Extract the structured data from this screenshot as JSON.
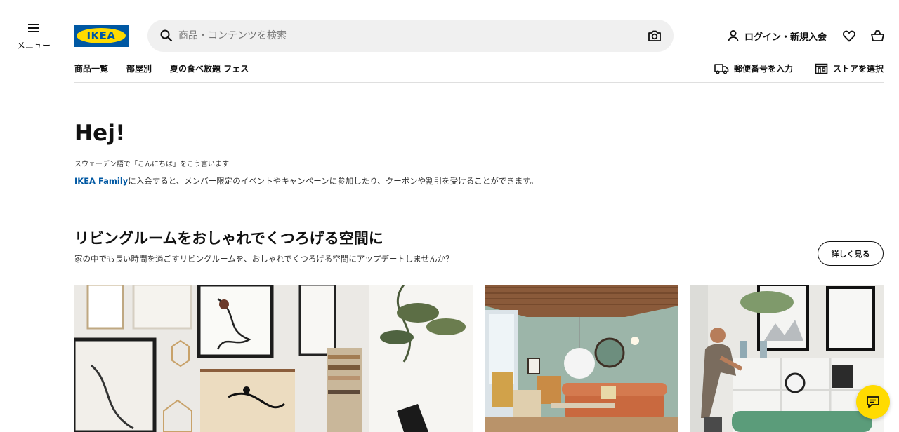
{
  "header": {
    "menu_label": "メニュー",
    "logo_text": "IKEA",
    "search_placeholder": "商品・コンテンツを検索",
    "login_label": "ログイン・新規入会"
  },
  "nav": {
    "items": [
      "商品一覧",
      "部屋別",
      "夏の食べ放題 フェス"
    ],
    "postal_label": "郵便番号を入力",
    "store_label": "ストアを選択"
  },
  "hero": {
    "title": "Hej!",
    "subtitle": "スウェーデン語で「こんにちは」をこう言います",
    "family_link": "IKEA Family",
    "description": "に入会すると、メンバー限定のイベントやキャンペーンに参加したり、クーポンや割引を受けることができます。"
  },
  "section": {
    "title": "リビングルームをおしゃれでくつろげる空間に",
    "subtitle": "家の中でも長い時間を過ごすリビングルームを、おしゃれでくつろげる空間にアップデートしませんか？",
    "more_button": "詳しく見る"
  },
  "colors": {
    "brand_blue": "#0058a3",
    "brand_yellow": "#ffdb00"
  },
  "icons": [
    "menu-icon",
    "search-icon",
    "camera-icon",
    "user-icon",
    "heart-icon",
    "bag-icon",
    "truck-icon",
    "store-icon",
    "chat-icon"
  ]
}
